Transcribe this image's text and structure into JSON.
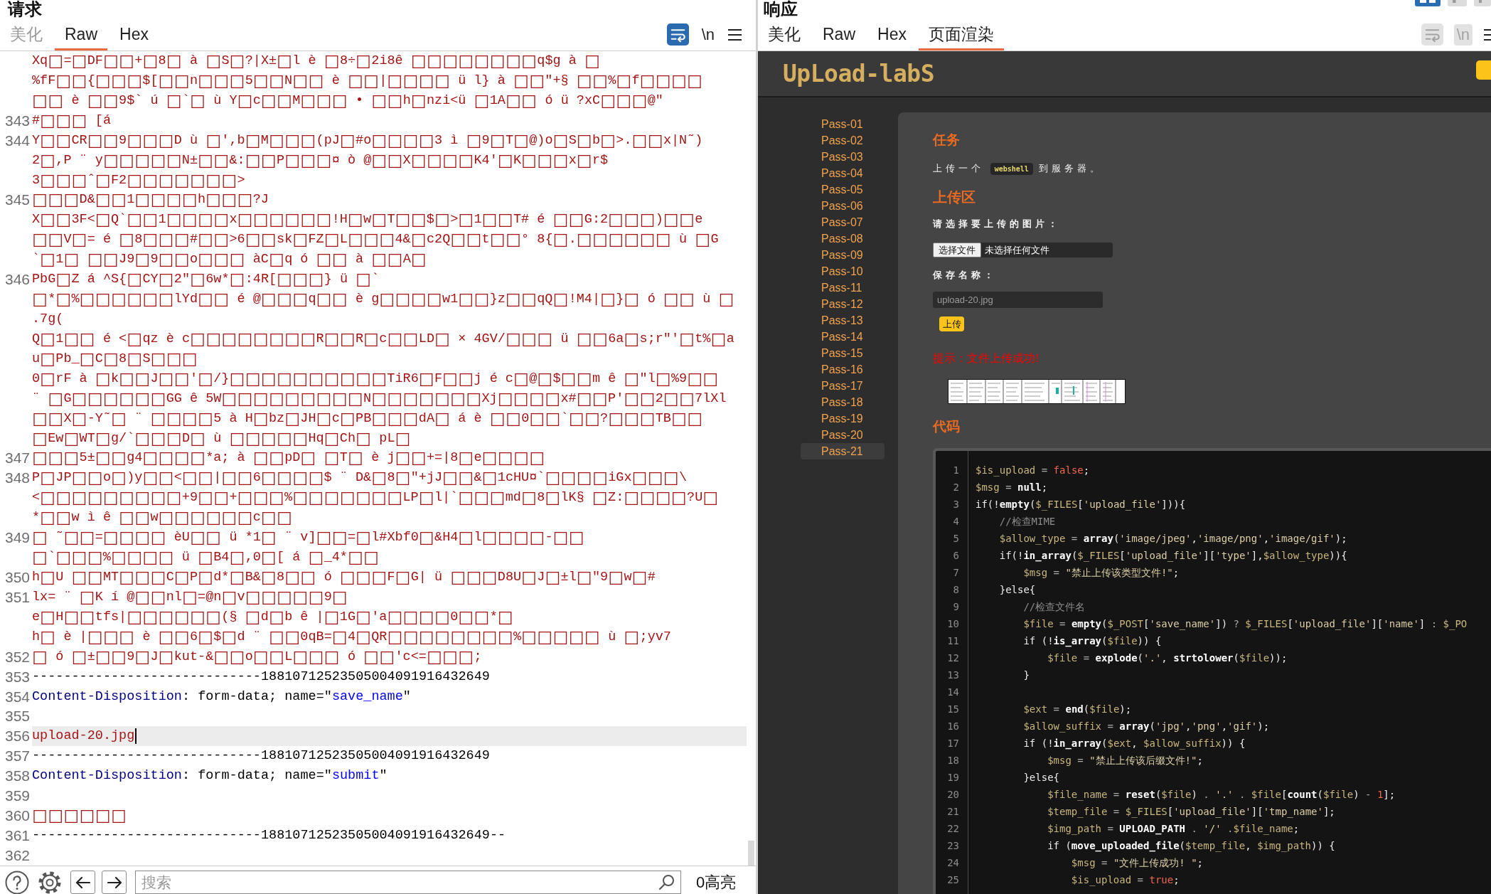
{
  "request": {
    "title": "请求",
    "tabs": [
      {
        "label": "美化",
        "selected": false,
        "disabled": true
      },
      {
        "label": "Raw",
        "selected": true,
        "disabled": false
      },
      {
        "label": "Hex",
        "selected": false,
        "disabled": false
      }
    ],
    "wrap_toggle": {
      "on": true
    },
    "newline_toggle": {
      "label": "\\n",
      "disabled": false
    },
    "editor": {
      "lines": [
        {
          "current": false,
          "rows": [
            [
              {
                "kind": "body",
                "text": "Xq□=□DF□□+□8□ à □S□?|X±□l è □8÷□2i8ê □□□□□□□□q$g à □"
              }
            ],
            [
              {
                "kind": "body",
                "text": "%fF□□{□□□$[□□n□□□5□□N□□ è □□|□□□□ ü l} à □□\"+§ □□%□f□□□□"
              }
            ],
            [
              {
                "kind": "body",
                "text": "□□ è □□9$` ú □`□ ù Y□c□□M□□□ • □□h□nzi<ü □1A□□ ó ü ?xC□□□@\""
              }
            ]
          ]
        },
        {
          "number": "343",
          "current": false,
          "rows": [
            [
              {
                "kind": "body",
                "text": "#□□□ [á"
              }
            ]
          ]
        },
        {
          "number": "344",
          "current": false,
          "rows": [
            [
              {
                "kind": "body",
                "text": "Y□□CR□□9□□□D ù □',b□M□□□(pJ□#o□□□□3 ì □9□T□@)o□S□b□>.□□x|N˜)"
              }
            ],
            [
              {
                "kind": "body",
                "text": "2□,P ¨ y□□□□□N±□□&:□□P□□□¤ ò @□□X□□□□K4'□K□□□x□r$"
              }
            ],
            [
              {
                "kind": "body",
                "text": "3□□□ˆ□F2□□□□□□□>"
              }
            ]
          ]
        },
        {
          "number": "345",
          "current": false,
          "rows": [
            [
              {
                "kind": "body",
                "text": "□□□D&□□1□□□□h□□□?J"
              }
            ],
            [
              {
                "kind": "body",
                "text": "X□□3F<□Q`□□1□□□□x□□□□□□!H□w□T□□$□>□1□□T# é □□G:2□□□)□□e"
              }
            ],
            [
              {
                "kind": "body",
                "text": "□□V□= é □8□□□#□□>6□□sk□FZ□L□□□4&□c2Q□□t□□° 8{□.□□□□□□ ù □G"
              }
            ],
            [
              {
                "kind": "body",
                "text": "`□1□ □□J9□9□□o□□□ àC□q ó □□ à □□A□"
              }
            ]
          ]
        },
        {
          "number": "346",
          "current": false,
          "rows": [
            [
              {
                "kind": "body",
                "text": "PbG□Z á ^S{□CY□2\"□6w*□:4R[□□□} ü □`"
              }
            ],
            [
              {
                "kind": "body",
                "text": "□*□%□□□□□□lYd□□ é @□□□q□□ è g□□□□w1□□}z□□qQ□!M4|□}□ ó □□ ù □"
              }
            ],
            [
              {
                "kind": "body",
                "text": ".7g("
              }
            ],
            [
              {
                "kind": "body",
                "text": "Q□1□□ é <□qz è c□□□□□□□□R□□R□c□□LD□ × 4GV/□□□ ü □□6a□s;r\"'□t%□a"
              }
            ],
            [
              {
                "kind": "body",
                "text": "u□Pb_□C□8□S□□□"
              }
            ],
            [
              {
                "kind": "body",
                "text": "0□rF à □k□□J□□'□/}□□□□□□□□□□TiR6□F□□j é c□@□$□□m ê □\"l□%9□□"
              }
            ],
            [
              {
                "kind": "body",
                "text": "¨ □G□□□□□□GG ê 5W□□□□□□□□□N□□□□□□□Xj□□□□x#□□P'□□2□□7lXl"
              }
            ],
            [
              {
                "kind": "body",
                "text": "□□X□-Y˜□ ¨ □□□□5 à H□bz□JH□c□PB□□□dA□ á è □□0□□`□□?□□□TB□□"
              }
            ],
            [
              {
                "kind": "body",
                "text": "□Ew□WT□g/`□□□D□ ù □□□□□Hq□Ch□ pL□"
              }
            ]
          ]
        },
        {
          "number": "347",
          "current": false,
          "rows": [
            [
              {
                "kind": "body",
                "text": "□□□5±□□g4□□□□*a; à □□pD□ □T□ è j□□+=|8□e□□□□"
              }
            ]
          ]
        },
        {
          "number": "348",
          "current": false,
          "rows": [
            [
              {
                "kind": "body",
                "text": "P□JP□□o□)y□□<□□|□□6□□□□$ ¨ D&□8□\"+jJ□□&□1cHU¤`□□□□iGx□□□\\"
              }
            ],
            [
              {
                "kind": "body",
                "text": "<□□□□□□□□□+9□□+□□□%□□□□□□□LP□l|`□□□md□8□lK§ □Z:□□□□?U□"
              }
            ],
            [
              {
                "kind": "body",
                "text": "*□□w ì ê □□w□□□□□□c□□"
              }
            ]
          ]
        },
        {
          "number": "349",
          "current": false,
          "rows": [
            [
              {
                "kind": "body",
                "text": "□ ˜□□=□□□□ èU□□ ü *1□ ¨ v]□□=□l#Xbf0□&H4□l□□□□-□□"
              }
            ],
            [
              {
                "kind": "body",
                "text": "□`□□□%□□□□ ü □B4□,0□[ á □_4*□□"
              }
            ]
          ]
        },
        {
          "number": "350",
          "current": false,
          "rows": [
            [
              {
                "kind": "body",
                "text": "h□U □□MT□□□C□P□d*□B&□8□□ ó □□□F□G| ü □□□D8U□J□±l□\"9□w□#"
              }
            ]
          ]
        },
        {
          "number": "351",
          "current": false,
          "rows": [
            [
              {
                "kind": "body",
                "text": "lx= ¨ □K í @□□nl□=@n□v□□□□□9□"
              }
            ],
            [
              {
                "kind": "body",
                "text": "e□H□□tfs|□□□□□□(§ □d□b ê |□1G□'a□□□□0□□*□"
              }
            ],
            [
              {
                "kind": "body",
                "text": "h□ è |□□□ è □□6□$□d ¨ □□0qB=□4□QR□□□□□□□□%□□□□□ ù □;yv7"
              }
            ]
          ]
        },
        {
          "number": "352",
          "current": false,
          "rows": [
            [
              {
                "kind": "body",
                "text": "□ ó □±□□9□J□kut-&□□o□□L□□□ ó □□'c<=□□□;"
              }
            ]
          ]
        },
        {
          "number": "353",
          "current": false,
          "rows": [
            [
              {
                "kind": "plain",
                "text": "-----------------------------18810712523505004091916432649"
              }
            ]
          ]
        },
        {
          "number": "354",
          "current": false,
          "rows": [
            [
              {
                "kind": "header",
                "text": "Content-Disposition"
              },
              {
                "kind": "plain",
                "text": ": form-data; name=\""
              },
              {
                "kind": "value",
                "text": "save_name"
              },
              {
                "kind": "plain",
                "text": "\""
              }
            ]
          ]
        },
        {
          "number": "355",
          "current": false
        },
        {
          "number": "356",
          "current": true,
          "rows": [
            [
              {
                "kind": "body",
                "text": "upload-20.jpg"
              }
            ]
          ]
        },
        {
          "number": "357",
          "current": false,
          "rows": [
            [
              {
                "kind": "plain",
                "text": "-----------------------------18810712523505004091916432649"
              }
            ]
          ]
        },
        {
          "number": "358",
          "current": false,
          "rows": [
            [
              {
                "kind": "header",
                "text": "Content-Disposition"
              },
              {
                "kind": "plain",
                "text": ": form-data; name=\""
              },
              {
                "kind": "value",
                "text": "submit"
              },
              {
                "kind": "plain",
                "text": "\""
              }
            ]
          ]
        },
        {
          "number": "359",
          "current": false
        },
        {
          "number": "360",
          "current": false,
          "rows": [
            [
              {
                "kind": "body",
                "text": "□□□□□□"
              }
            ]
          ]
        },
        {
          "number": "361",
          "current": false,
          "rows": [
            [
              {
                "kind": "plain",
                "text": "-----------------------------18810712523505004091916432649--"
              }
            ]
          ]
        },
        {
          "number": "362",
          "current": false
        }
      ]
    },
    "footer": {
      "search": {
        "placeholder": "搜索"
      },
      "highlight_count": "0高亮"
    }
  },
  "response": {
    "title": "响应",
    "layout_buttons": [
      {
        "selected": true
      },
      {
        "selected": false
      },
      {
        "selected": false
      }
    ],
    "tabs": [
      {
        "label": "美化",
        "selected": false,
        "disabled": false
      },
      {
        "label": "Raw",
        "selected": false,
        "disabled": false
      },
      {
        "label": "Hex",
        "selected": false,
        "disabled": false
      },
      {
        "label": "页面渲染",
        "selected": true,
        "disabled": false
      }
    ],
    "wrap_toggle": {
      "on": false,
      "disabled": true
    },
    "newline_toggle": {
      "label": "\\n",
      "disabled": true
    },
    "page": {
      "logo": "UpLoad-labS",
      "sidebar": {
        "items": [
          {
            "label": "Pass-01",
            "selected": false
          },
          {
            "label": "Pass-02",
            "selected": false
          },
          {
            "label": "Pass-03",
            "selected": false
          },
          {
            "label": "Pass-04",
            "selected": false
          },
          {
            "label": "Pass-05",
            "selected": false
          },
          {
            "label": "Pass-06",
            "selected": false
          },
          {
            "label": "Pass-07",
            "selected": false
          },
          {
            "label": "Pass-08",
            "selected": false
          },
          {
            "label": "Pass-09",
            "selected": false
          },
          {
            "label": "Pass-10",
            "selected": false
          },
          {
            "label": "Pass-11",
            "selected": false
          },
          {
            "label": "Pass-12",
            "selected": false
          },
          {
            "label": "Pass-13",
            "selected": false
          },
          {
            "label": "Pass-14",
            "selected": false
          },
          {
            "label": "Pass-15",
            "selected": false
          },
          {
            "label": "Pass-16",
            "selected": false
          },
          {
            "label": "Pass-17",
            "selected": false
          },
          {
            "label": "Pass-18",
            "selected": false
          },
          {
            "label": "Pass-19",
            "selected": false
          },
          {
            "label": "Pass-20",
            "selected": false
          },
          {
            "label": "Pass-21",
            "selected": true
          }
        ]
      },
      "task": {
        "heading": "任务",
        "before": "上传一个",
        "code": "webshell",
        "after": "到服务器。"
      },
      "upload": {
        "heading": "上传区",
        "file_label": "请选择要上传的图片：",
        "file_button": "选择文件",
        "file_status": "未选择任何文件",
        "name_label": "保存名称：",
        "name_value": "upload-20.jpg",
        "submit": "上传"
      },
      "message": "提示：文件上传成功!",
      "code": {
        "heading": "代码",
        "lines": [
          {
            "number": "1",
            "segments": [
              {
                "kind": "var",
                "text": "$is_upload"
              },
              {
                "kind": "op",
                "text": " = "
              },
              {
                "kind": "kw",
                "text": "false"
              },
              {
                "kind": "plain",
                "text": ";"
              }
            ]
          },
          {
            "number": "2",
            "segments": [
              {
                "kind": "var",
                "text": "$msg"
              },
              {
                "kind": "op",
                "text": " = "
              },
              {
                "kind": "fn",
                "text": "null"
              },
              {
                "kind": "plain",
                "text": ";"
              }
            ]
          },
          {
            "number": "3",
            "segments": [
              {
                "kind": "plain",
                "text": "if(!"
              },
              {
                "kind": "fn",
                "text": "empty"
              },
              {
                "kind": "plain",
                "text": "("
              },
              {
                "kind": "var",
                "text": "$_FILES"
              },
              {
                "kind": "plain",
                "text": "["
              },
              {
                "kind": "str",
                "text": "'upload_file'"
              },
              {
                "kind": "plain",
                "text": "])){"
              }
            ]
          },
          {
            "number": "4",
            "segments": [
              {
                "kind": "cmt",
                "text": "    //检查MIME"
              }
            ]
          },
          {
            "number": "5",
            "segments": [
              {
                "kind": "var",
                "text": "    $allow_type"
              },
              {
                "kind": "op",
                "text": " = "
              },
              {
                "kind": "fn",
                "text": "array"
              },
              {
                "kind": "plain",
                "text": "("
              },
              {
                "kind": "str",
                "text": "'image/jpeg'"
              },
              {
                "kind": "plain",
                "text": ","
              },
              {
                "kind": "str",
                "text": "'image/png'"
              },
              {
                "kind": "plain",
                "text": ","
              },
              {
                "kind": "str",
                "text": "'image/gif'"
              },
              {
                "kind": "plain",
                "text": ");"
              }
            ]
          },
          {
            "number": "6",
            "segments": [
              {
                "kind": "plain",
                "text": "    if(!"
              },
              {
                "kind": "fn",
                "text": "in_array"
              },
              {
                "kind": "plain",
                "text": "("
              },
              {
                "kind": "var",
                "text": "$_FILES"
              },
              {
                "kind": "plain",
                "text": "["
              },
              {
                "kind": "str",
                "text": "'upload_file'"
              },
              {
                "kind": "plain",
                "text": "]["
              },
              {
                "kind": "str",
                "text": "'type'"
              },
              {
                "kind": "plain",
                "text": "],"
              },
              {
                "kind": "var",
                "text": "$allow_type"
              },
              {
                "kind": "plain",
                "text": ")){"
              }
            ]
          },
          {
            "number": "7",
            "segments": [
              {
                "kind": "var",
                "text": "        $msg"
              },
              {
                "kind": "op",
                "text": " = "
              },
              {
                "kind": "str",
                "text": "\"禁止上传该类型文件!\""
              },
              {
                "kind": "plain",
                "text": ";"
              }
            ]
          },
          {
            "number": "8",
            "segments": [
              {
                "kind": "plain",
                "text": "    }else{"
              }
            ]
          },
          {
            "number": "9",
            "segments": [
              {
                "kind": "cmt",
                "text": "        //检查文件名"
              }
            ]
          },
          {
            "number": "10",
            "segments": [
              {
                "kind": "var",
                "text": "        $file"
              },
              {
                "kind": "op",
                "text": " = "
              },
              {
                "kind": "fn",
                "text": "empty"
              },
              {
                "kind": "plain",
                "text": "("
              },
              {
                "kind": "var",
                "text": "$_POST"
              },
              {
                "kind": "plain",
                "text": "["
              },
              {
                "kind": "str",
                "text": "'save_name'"
              },
              {
                "kind": "plain",
                "text": "])"
              },
              {
                "kind": "op",
                "text": " ? "
              },
              {
                "kind": "var",
                "text": "$_FILES"
              },
              {
                "kind": "plain",
                "text": "["
              },
              {
                "kind": "str",
                "text": "'upload_file'"
              },
              {
                "kind": "plain",
                "text": "]["
              },
              {
                "kind": "str",
                "text": "'name'"
              },
              {
                "kind": "plain",
                "text": "]"
              },
              {
                "kind": "op",
                "text": " : "
              },
              {
                "kind": "var",
                "text": "$_PO"
              }
            ]
          },
          {
            "number": "11",
            "segments": [
              {
                "kind": "plain",
                "text": "        if (!"
              },
              {
                "kind": "fn",
                "text": "is_array"
              },
              {
                "kind": "plain",
                "text": "("
              },
              {
                "kind": "var",
                "text": "$file"
              },
              {
                "kind": "plain",
                "text": ")) {"
              }
            ]
          },
          {
            "number": "12",
            "segments": [
              {
                "kind": "var",
                "text": "            $file"
              },
              {
                "kind": "op",
                "text": " = "
              },
              {
                "kind": "fn",
                "text": "explode"
              },
              {
                "kind": "plain",
                "text": "("
              },
              {
                "kind": "str",
                "text": "'.'"
              },
              {
                "kind": "plain",
                "text": ", "
              },
              {
                "kind": "fn",
                "text": "strtolower"
              },
              {
                "kind": "plain",
                "text": "("
              },
              {
                "kind": "var",
                "text": "$file"
              },
              {
                "kind": "plain",
                "text": "));"
              }
            ]
          },
          {
            "number": "13",
            "segments": [
              {
                "kind": "plain",
                "text": "        }"
              }
            ]
          },
          {
            "number": "14"
          },
          {
            "number": "15",
            "segments": [
              {
                "kind": "var",
                "text": "        $ext"
              },
              {
                "kind": "op",
                "text": " = "
              },
              {
                "kind": "fn",
                "text": "end"
              },
              {
                "kind": "plain",
                "text": "("
              },
              {
                "kind": "var",
                "text": "$file"
              },
              {
                "kind": "plain",
                "text": ");"
              }
            ]
          },
          {
            "number": "16",
            "segments": [
              {
                "kind": "var",
                "text": "        $allow_suffix"
              },
              {
                "kind": "op",
                "text": " = "
              },
              {
                "kind": "fn",
                "text": "array"
              },
              {
                "kind": "plain",
                "text": "("
              },
              {
                "kind": "str",
                "text": "'jpg'"
              },
              {
                "kind": "plain",
                "text": ","
              },
              {
                "kind": "str",
                "text": "'png'"
              },
              {
                "kind": "plain",
                "text": ","
              },
              {
                "kind": "str",
                "text": "'gif'"
              },
              {
                "kind": "plain",
                "text": ");"
              }
            ]
          },
          {
            "number": "17",
            "segments": [
              {
                "kind": "plain",
                "text": "        if (!"
              },
              {
                "kind": "fn",
                "text": "in_array"
              },
              {
                "kind": "plain",
                "text": "("
              },
              {
                "kind": "var",
                "text": "$ext"
              },
              {
                "kind": "plain",
                "text": ", "
              },
              {
                "kind": "var",
                "text": "$allow_suffix"
              },
              {
                "kind": "plain",
                "text": ")) {"
              }
            ]
          },
          {
            "number": "18",
            "segments": [
              {
                "kind": "var",
                "text": "            $msg"
              },
              {
                "kind": "op",
                "text": " = "
              },
              {
                "kind": "str",
                "text": "\"禁止上传该后缀文件!\""
              },
              {
                "kind": "plain",
                "text": ";"
              }
            ]
          },
          {
            "number": "19",
            "segments": [
              {
                "kind": "plain",
                "text": "        }else{"
              }
            ]
          },
          {
            "number": "20",
            "segments": [
              {
                "kind": "var",
                "text": "            $file_name"
              },
              {
                "kind": "op",
                "text": " = "
              },
              {
                "kind": "fn",
                "text": "reset"
              },
              {
                "kind": "plain",
                "text": "("
              },
              {
                "kind": "var",
                "text": "$file"
              },
              {
                "kind": "plain",
                "text": ")"
              },
              {
                "kind": "op",
                "text": " . "
              },
              {
                "kind": "str",
                "text": "'.'"
              },
              {
                "kind": "op",
                "text": " . "
              },
              {
                "kind": "var",
                "text": "$file"
              },
              {
                "kind": "plain",
                "text": "["
              },
              {
                "kind": "fn",
                "text": "count"
              },
              {
                "kind": "plain",
                "text": "("
              },
              {
                "kind": "var",
                "text": "$file"
              },
              {
                "kind": "plain",
                "text": ")"
              },
              {
                "kind": "op",
                "text": " - "
              },
              {
                "kind": "num",
                "text": "1"
              },
              {
                "kind": "plain",
                "text": "];"
              }
            ]
          },
          {
            "number": "21",
            "segments": [
              {
                "kind": "var",
                "text": "            $temp_file"
              },
              {
                "kind": "op",
                "text": " = "
              },
              {
                "kind": "var",
                "text": "$_FILES"
              },
              {
                "kind": "plain",
                "text": "["
              },
              {
                "kind": "str",
                "text": "'upload_file'"
              },
              {
                "kind": "plain",
                "text": "]["
              },
              {
                "kind": "str",
                "text": "'tmp_name'"
              },
              {
                "kind": "plain",
                "text": "];"
              }
            ]
          },
          {
            "number": "22",
            "segments": [
              {
                "kind": "var",
                "text": "            $img_path"
              },
              {
                "kind": "op",
                "text": " = "
              },
              {
                "kind": "fn",
                "text": "UPLOAD_PATH"
              },
              {
                "kind": "op",
                "text": " . "
              },
              {
                "kind": "str",
                "text": "'/'"
              },
              {
                "kind": "op",
                "text": " ."
              },
              {
                "kind": "var",
                "text": "$file_name"
              },
              {
                "kind": "plain",
                "text": ";"
              }
            ]
          },
          {
            "number": "23",
            "segments": [
              {
                "kind": "plain",
                "text": "            if ("
              },
              {
                "kind": "fn",
                "text": "move_uploaded_file"
              },
              {
                "kind": "plain",
                "text": "("
              },
              {
                "kind": "var",
                "text": "$temp_file"
              },
              {
                "kind": "plain",
                "text": ", "
              },
              {
                "kind": "var",
                "text": "$img_path"
              },
              {
                "kind": "plain",
                "text": ")) {"
              }
            ]
          },
          {
            "number": "24",
            "segments": [
              {
                "kind": "var",
                "text": "                $msg"
              },
              {
                "kind": "op",
                "text": " = "
              },
              {
                "kind": "str",
                "text": "\"文件上传成功! \""
              },
              {
                "kind": "plain",
                "text": ";"
              }
            ]
          },
          {
            "number": "25",
            "segments": [
              {
                "kind": "var",
                "text": "                $is_upload"
              },
              {
                "kind": "op",
                "text": " = "
              },
              {
                "kind": "kw",
                "text": "true"
              },
              {
                "kind": "plain",
                "text": ";"
              }
            ]
          }
        ]
      }
    }
  }
}
